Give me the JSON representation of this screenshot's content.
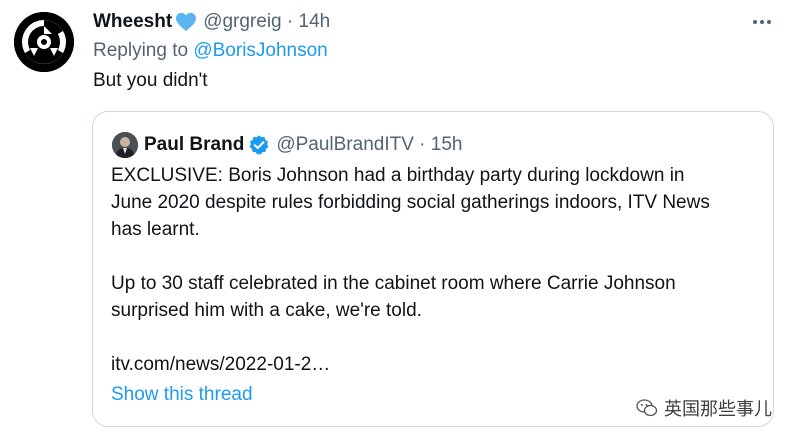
{
  "tweet": {
    "author_name": "Wheesht",
    "handle_time": "@grgreig · 14h",
    "replying_prefix": "Replying to ",
    "replying_to": "@BorisJohnson",
    "text": "But you didn't"
  },
  "quoted": {
    "author_name": "Paul Brand",
    "handle_time": "@PaulBrandITV · 15h",
    "paragraph1_lines": [
      "EXCLUSIVE: Boris Johnson had a birthday party during lockdown in",
      "June 2020 despite rules forbidding social gatherings indoors, ITV News",
      "has learnt."
    ],
    "paragraph2_lines": [
      "Up to 30 staff celebrated in the cabinet room where Carrie Johnson",
      "surprised him with a cake, we're told."
    ],
    "link": "itv.com/news/2022-01-2…",
    "show_thread": "Show this thread"
  },
  "watermark": "英国那些事儿",
  "colors": {
    "link": "#1d9bf0",
    "muted": "#536471",
    "verified": "#1d9bf0",
    "border": "#cfd9de"
  },
  "icons": [
    "blue-heart-icon",
    "verified-badge-icon",
    "more-options-icon",
    "wechat-watermark-icon"
  ]
}
